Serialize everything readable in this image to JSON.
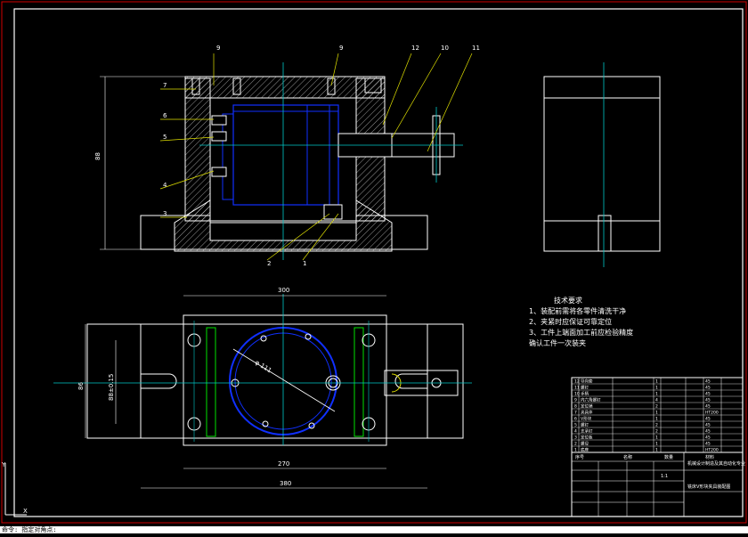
{
  "drawing": {
    "part_labels": {
      "top": [
        "9",
        "9",
        "12",
        "10",
        "11"
      ],
      "left": [
        "7",
        "6",
        "5",
        "4",
        "3"
      ],
      "bottom": [
        "2",
        "1"
      ]
    },
    "dimensions": {
      "front_height": "88",
      "top_width": "300",
      "base_inner": "270",
      "base_overall": "380",
      "left_height": "86",
      "left_height2": "88±0.15",
      "circle_dia": "φ 111"
    },
    "technical_notes": {
      "title": "技术要求",
      "items": [
        "1、装配前需将各零件清洗干净",
        "2、夹紧时应保证可靠定位",
        "3、工件上端面加工前应检验精度",
        "    确认工件一次装夹"
      ]
    },
    "title_block": {
      "scale": "1:1",
      "drawing_title": "铣床V形块夹具装配图",
      "school": "机械设计制造及其自动化专业",
      "rows": [
        [
          "12",
          "导向套",
          "1",
          "45"
        ],
        [
          "11",
          "螺钉",
          "1",
          "45"
        ],
        [
          "10",
          "手柄",
          "1",
          "45"
        ],
        [
          "9",
          "内六角螺钉",
          "4",
          "45"
        ],
        [
          "8",
          "定位销",
          "2",
          "45"
        ],
        [
          "7",
          "夹具体",
          "1",
          "HT200"
        ],
        [
          "6",
          "V形块",
          "1",
          "45"
        ],
        [
          "5",
          "螺钉",
          "2",
          "45"
        ],
        [
          "4",
          "支承钉",
          "2",
          "45"
        ],
        [
          "3",
          "定位板",
          "1",
          "45"
        ],
        [
          "2",
          "螺母",
          "1",
          "45"
        ],
        [
          "1",
          "底座",
          "1",
          "HT200"
        ]
      ],
      "header": [
        "序号",
        "名称",
        "数量",
        "材料"
      ]
    }
  },
  "command_line": "命令: 指定对角点:"
}
